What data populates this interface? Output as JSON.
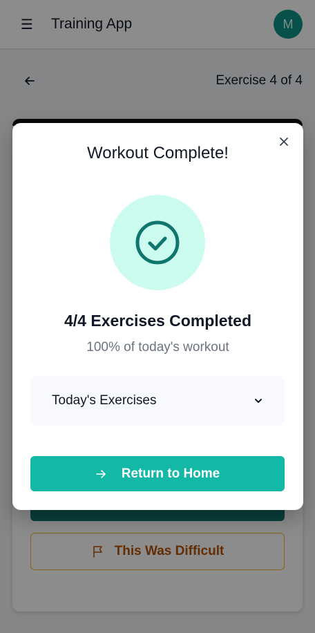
{
  "app": {
    "title": "Training App",
    "avatar_initial": "M"
  },
  "sub_header": {
    "exercise_counter": "Exercise 4 of 4"
  },
  "background_card": {
    "difficult_label": "This Was Difficult"
  },
  "modal": {
    "title": "Workout Complete!",
    "completed_heading": "4/4 Exercises Completed",
    "completed_sub": "100% of today's workout",
    "accordion_label": "Today's Exercises",
    "return_label": "Return to Home"
  },
  "colors": {
    "primary_teal": "#14b8a6",
    "avatar_teal": "#0d9488",
    "success_bg": "#ccfbef",
    "warning_border": "#f0b429",
    "warning_text": "#b45309"
  },
  "icons": {
    "menu": "menu-icon",
    "back": "arrow-left-icon",
    "close": "close-icon",
    "check": "check-circle-icon",
    "chevron": "chevron-down-icon",
    "return": "arrow-right-icon",
    "flag": "flag-icon"
  }
}
